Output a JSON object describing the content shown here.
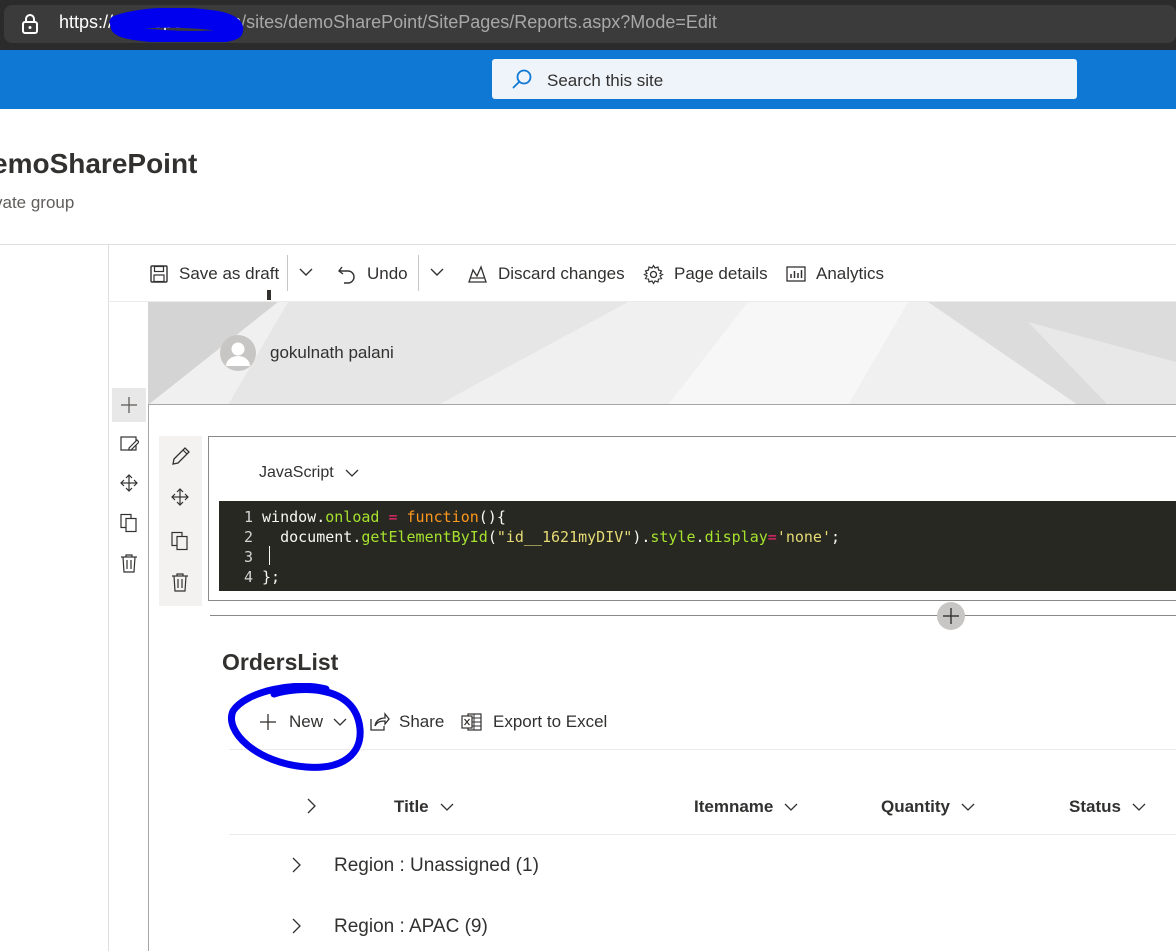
{
  "browser": {
    "url_host": "https://                sharepoint.com",
    "url_path": "/sites/demoSharePoint/SitePages/Reports.aspx?Mode=Edit"
  },
  "suite": {
    "search_placeholder": "Search this site",
    "accent": "#0f78d4"
  },
  "site": {
    "title": "emoSharePoint",
    "subtitle": "vate group"
  },
  "command_bar": {
    "save_draft": "Save as draft",
    "undo": "Undo",
    "discard": "Discard changes",
    "page_details": "Page details",
    "analytics": "Analytics"
  },
  "page": {
    "author": "gokulnath palani"
  },
  "code_part": {
    "language": "JavaScript",
    "lines": [
      {
        "n": "1",
        "text": "window.onload = function(){"
      },
      {
        "n": "2",
        "text": "  document.getElementById(\"id__1621myDIV\").style.display='none';"
      },
      {
        "n": "3",
        "text": "  "
      },
      {
        "n": "4",
        "text": "};"
      }
    ]
  },
  "list": {
    "title": "OrdersList",
    "new_label": "New",
    "share_label": "Share",
    "export_label": "Export to Excel",
    "columns": [
      "Title",
      "Itemname",
      "Quantity",
      "Status"
    ],
    "groups": [
      "Region : Unassigned (1)",
      "Region : APAC (9)"
    ]
  },
  "icons": [
    "lock-icon",
    "search-icon",
    "save-icon",
    "chevron-down-icon",
    "undo-icon",
    "discard-icon",
    "gear-icon",
    "analytics-icon",
    "person-icon",
    "plus-icon",
    "edit-icon",
    "move-icon",
    "copy-icon",
    "delete-icon",
    "share-icon",
    "excel-icon",
    "chevron-right-icon"
  ],
  "annotation_color": "#0000ee"
}
